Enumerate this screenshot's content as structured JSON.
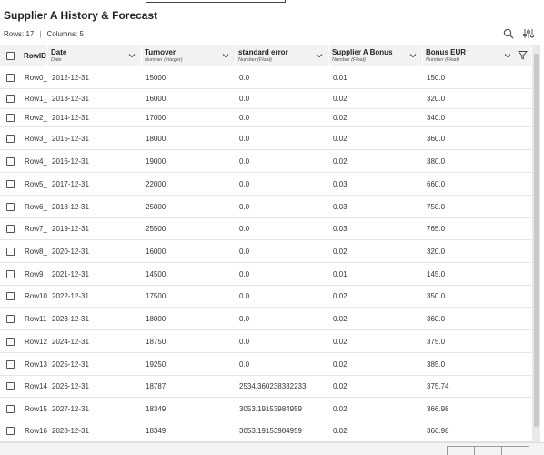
{
  "title": "Supplier A History & Forecast",
  "meta": {
    "rows_label": "Rows: 17",
    "separator": "|",
    "columns_label": "Columns: 5"
  },
  "toolbar": {
    "search_icon": "search-icon",
    "settings_icon": "sliders-icon"
  },
  "columns": [
    {
      "key": "rowid",
      "name": "RowID",
      "type": ""
    },
    {
      "key": "date",
      "name": "Date",
      "type": "Date"
    },
    {
      "key": "turnover",
      "name": "Turnover",
      "type": "Number (integer)"
    },
    {
      "key": "stderr",
      "name": "standard error",
      "type": "Number (Float)"
    },
    {
      "key": "bonus",
      "name": "Supplier A Bonus",
      "type": "Number (Float)"
    },
    {
      "key": "bonus_eur",
      "name": "Bonus EUR",
      "type": "Number (Float)"
    }
  ],
  "rows": [
    [
      "Row0_",
      "2012-12-31",
      "15000",
      "0.0",
      "0.01",
      "150.0"
    ],
    [
      "Row1_",
      "2013-12-31",
      "16000",
      "0.0",
      "0.02",
      "320.0"
    ],
    [
      "Row2_",
      "2014-12-31",
      "17000",
      "0.0",
      "0.02",
      "340.0"
    ],
    [
      "Row3_",
      "2015-12-31",
      "18000",
      "0.0",
      "0.02",
      "360.0"
    ],
    [
      "Row4_",
      "2016-12-31",
      "19000",
      "0.0",
      "0.02",
      "380.0"
    ],
    [
      "Row5_",
      "2017-12-31",
      "22000",
      "0.0",
      "0.03",
      "660.0"
    ],
    [
      "Row6_",
      "2018-12-31",
      "25000",
      "0.0",
      "0.03",
      "750.0"
    ],
    [
      "Row7_",
      "2019-12-31",
      "25500",
      "0.0",
      "0.03",
      "765.0"
    ],
    [
      "Row8_",
      "2020-12-31",
      "16000",
      "0.0",
      "0.02",
      "320.0"
    ],
    [
      "Row9_",
      "2021-12-31",
      "14500",
      "0.0",
      "0.01",
      "145.0"
    ],
    [
      "Row10",
      "2022-12-31",
      "17500",
      "0.0",
      "0.02",
      "350.0"
    ],
    [
      "Row11",
      "2023-12-31",
      "18000",
      "0.0",
      "0.02",
      "360.0"
    ],
    [
      "Row12",
      "2024-12-31",
      "18750",
      "0.0",
      "0.02",
      "375.0"
    ],
    [
      "Row13",
      "2025-12-31",
      "19250",
      "0.0",
      "0.02",
      "385.0"
    ],
    [
      "Row14",
      "2026-12-31",
      "18787",
      "2534.360238332233",
      "0.02",
      "375.74"
    ],
    [
      "Row15",
      "2027-12-31",
      "18349",
      "3053.19153984959",
      "0.02",
      "366.98"
    ],
    [
      "Row16",
      "2028-12-31",
      "18349",
      "3053.19153984959",
      "0.02",
      "366.98"
    ]
  ]
}
